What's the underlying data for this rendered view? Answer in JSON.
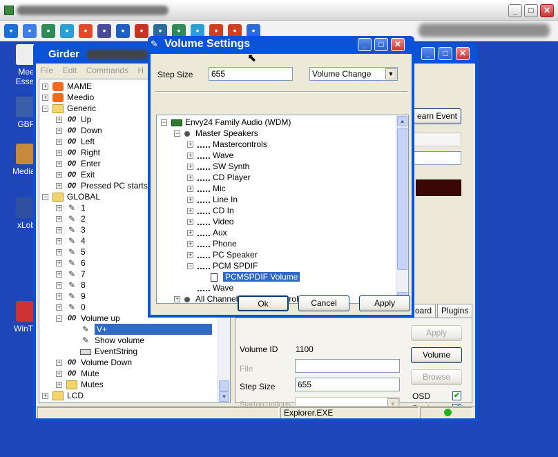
{
  "toolbar": {
    "icons": [
      "tool-icon-1",
      "window-icon",
      "globe-icon",
      "refresh-icon",
      "windows-flag-icon",
      "abc-icon",
      "info-icon",
      "no-entry-icon",
      "network-icon",
      "tools-icon",
      "arrow-box-icon",
      "crosshair-icon",
      "crosshair-red-icon",
      "link-icon"
    ]
  },
  "desktop": {
    "icons": [
      {
        "label": "Mee\nEsser"
      },
      {
        "label": "GBP"
      },
      {
        "label": "MediaF"
      },
      {
        "label": "xLob"
      },
      {
        "label": "WinTV"
      }
    ]
  },
  "girder": {
    "title": "Girder",
    "menu": [
      "File",
      "Edit",
      "Commands",
      "H"
    ],
    "tree": [
      {
        "text": "MAME",
        "icon": "device",
        "level": 0,
        "pm": "+"
      },
      {
        "text": "Meedio",
        "icon": "device",
        "level": 0,
        "pm": "+"
      },
      {
        "text": "Generic",
        "icon": "folder",
        "level": 0,
        "pm": "-"
      },
      {
        "text": "Up",
        "icon": "remote",
        "level": 1,
        "pm": "+"
      },
      {
        "text": "Down",
        "icon": "remote",
        "level": 1,
        "pm": "+"
      },
      {
        "text": "Left",
        "icon": "remote",
        "level": 1,
        "pm": "+"
      },
      {
        "text": "Right",
        "icon": "remote",
        "level": 1,
        "pm": "+"
      },
      {
        "text": "Enter",
        "icon": "remote",
        "level": 1,
        "pm": "+"
      },
      {
        "text": "Exit",
        "icon": "remote",
        "level": 1,
        "pm": "+"
      },
      {
        "text": "Pressed PC starts M",
        "icon": "remote",
        "level": 1,
        "pm": "+"
      },
      {
        "text": "GLOBAL",
        "icon": "folder",
        "level": 0,
        "pm": "-"
      },
      {
        "text": "1",
        "icon": "pen",
        "level": 1,
        "pm": "+"
      },
      {
        "text": "2",
        "icon": "pen",
        "level": 1,
        "pm": "+"
      },
      {
        "text": "3",
        "icon": "pen",
        "level": 1,
        "pm": "+"
      },
      {
        "text": "4",
        "icon": "pen",
        "level": 1,
        "pm": "+"
      },
      {
        "text": "5",
        "icon": "pen",
        "level": 1,
        "pm": "+"
      },
      {
        "text": "6",
        "icon": "pen",
        "level": 1,
        "pm": "+"
      },
      {
        "text": "7",
        "icon": "pen",
        "level": 1,
        "pm": "+"
      },
      {
        "text": "8",
        "icon": "pen",
        "level": 1,
        "pm": "+"
      },
      {
        "text": "9",
        "icon": "pen",
        "level": 1,
        "pm": "+"
      },
      {
        "text": "0",
        "icon": "pen",
        "level": 1,
        "pm": "+"
      },
      {
        "text": "Volume up",
        "icon": "remote",
        "level": 1,
        "pm": "-"
      },
      {
        "text": "V+",
        "icon": "pen",
        "level": 2,
        "pm": "",
        "selected": true
      },
      {
        "text": "Show volume",
        "icon": "pen",
        "level": 2,
        "pm": ""
      },
      {
        "text": "EventString",
        "icon": "keyboard",
        "level": 2,
        "pm": ""
      },
      {
        "text": "Volume Down",
        "icon": "remote",
        "level": 1,
        "pm": "+"
      },
      {
        "text": "Mute",
        "icon": "remote",
        "level": 1,
        "pm": "+"
      },
      {
        "text": "Mutes",
        "icon": "folder",
        "level": 1,
        "pm": "+"
      },
      {
        "text": "LCD",
        "icon": "folder",
        "level": 0,
        "pm": "+"
      }
    ],
    "learn_event_label": "earn Event",
    "tabs": [
      "oard",
      "Plugins"
    ],
    "apply_label": "Apply",
    "volume_label": "Volume",
    "browse_label": "Browse",
    "volume_id_label": "Volume ID",
    "volume_id_value": "1100",
    "file_label": "File",
    "file_value": "",
    "step_size_label": "Step Size",
    "step_size_value": "655",
    "startup_label": "Startup options",
    "startup_value": "",
    "osd_label": "OSD",
    "osd_checked": "✔",
    "register_label": "Register",
    "register_checked": "✔",
    "status_text": "Explorer.EXE",
    "status_color": "#22b222"
  },
  "volume_dialog": {
    "title": "Volume Settings",
    "step_size_label": "Step Size",
    "step_size_value": "655",
    "mode_value": "Volume Change",
    "tree": [
      {
        "text": "Envy24 Family Audio (WDM)",
        "icon": "chip",
        "level": 0,
        "pm": "-"
      },
      {
        "text": "Master Speakers",
        "icon": "speaker",
        "level": 1,
        "pm": "-"
      },
      {
        "text": "Mastercontrols",
        "icon": "mixer",
        "level": 2,
        "pm": "+"
      },
      {
        "text": "Wave",
        "icon": "mixer",
        "level": 2,
        "pm": "+"
      },
      {
        "text": "SW Synth",
        "icon": "mixer",
        "level": 2,
        "pm": "+"
      },
      {
        "text": "CD Player",
        "icon": "mixer",
        "level": 2,
        "pm": "+"
      },
      {
        "text": "Mic",
        "icon": "mixer",
        "level": 2,
        "pm": "+"
      },
      {
        "text": "Line In",
        "icon": "mixer",
        "level": 2,
        "pm": "+"
      },
      {
        "text": "CD In",
        "icon": "mixer",
        "level": 2,
        "pm": "+"
      },
      {
        "text": "Video",
        "icon": "mixer",
        "level": 2,
        "pm": "+"
      },
      {
        "text": "Aux",
        "icon": "mixer",
        "level": 2,
        "pm": "+"
      },
      {
        "text": "Phone",
        "icon": "mixer",
        "level": 2,
        "pm": "+"
      },
      {
        "text": "PC Speaker",
        "icon": "mixer",
        "level": 2,
        "pm": "+"
      },
      {
        "text": "PCM SPDIF",
        "icon": "mixer",
        "level": 2,
        "pm": "-"
      },
      {
        "text": "PCMSPDIF Volume",
        "icon": "volume",
        "level": 3,
        "pm": "",
        "selected": true
      },
      {
        "text": "Wave",
        "icon": "mixer",
        "level": 2,
        "pm": ""
      },
      {
        "text": "All Channels Output Control",
        "icon": "speaker",
        "level": 1,
        "pm": "+"
      }
    ],
    "ok_label": "Ok",
    "cancel_label": "Cancel",
    "apply_label": "Apply"
  }
}
